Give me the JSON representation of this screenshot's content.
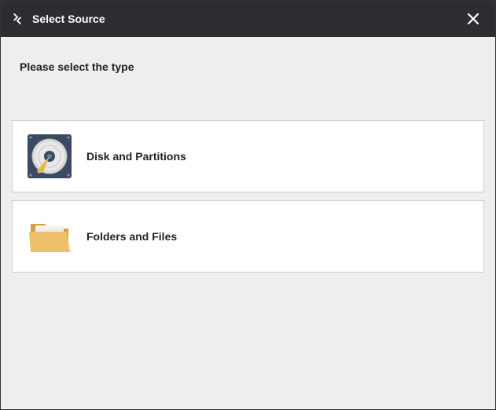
{
  "titlebar": {
    "title": "Select Source"
  },
  "content": {
    "prompt": "Please select the type"
  },
  "options": [
    {
      "label": "Disk and Partitions"
    },
    {
      "label": "Folders and Files"
    }
  ]
}
